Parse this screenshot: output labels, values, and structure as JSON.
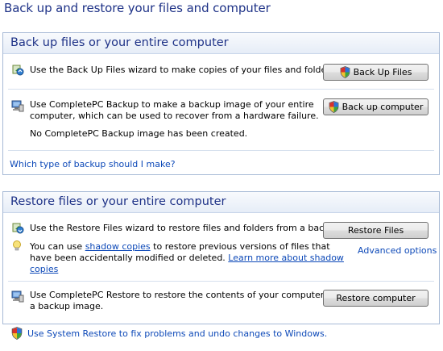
{
  "page_title": "Back up and restore your files and computer",
  "backup": {
    "header": "Back up files or your entire computer",
    "files_text": "Use the Back Up Files wizard to make copies of your files and folders.",
    "files_button": "Back Up Files",
    "computer_text_1": "Use CompletePC Backup to make a backup image of your entire",
    "computer_text_2": "computer, which can be used to recover from a hardware failure.",
    "computer_status": "No CompletePC Backup image has been created.",
    "computer_button": "Back up computer",
    "help_link": "Which type of backup should I make?"
  },
  "restore": {
    "header": "Restore files or your entire computer",
    "files_text": "Use the Restore Files wizard to restore files and folders from a backup.",
    "files_button": "Restore Files",
    "tip_pre": "You can use ",
    "tip_link_shadow": "shadow copies",
    "tip_mid": " to restore previous versions of files that",
    "tip_line2": "have been accidentally modified or deleted. ",
    "tip_learn_a": "Learn more about shadow",
    "tip_learn_b": "copies",
    "advanced_link": "Advanced options",
    "computer_text_1": "Use CompletePC Restore to restore the contents of your computer from",
    "computer_text_2": "a backup image.",
    "computer_button": "Restore computer"
  },
  "system_restore_link": "Use System Restore to fix problems and undo changes to Windows.",
  "colors": {
    "title_blue": "#1e3287",
    "link_blue": "#0d49b8",
    "panel_border": "#a7bad6"
  }
}
